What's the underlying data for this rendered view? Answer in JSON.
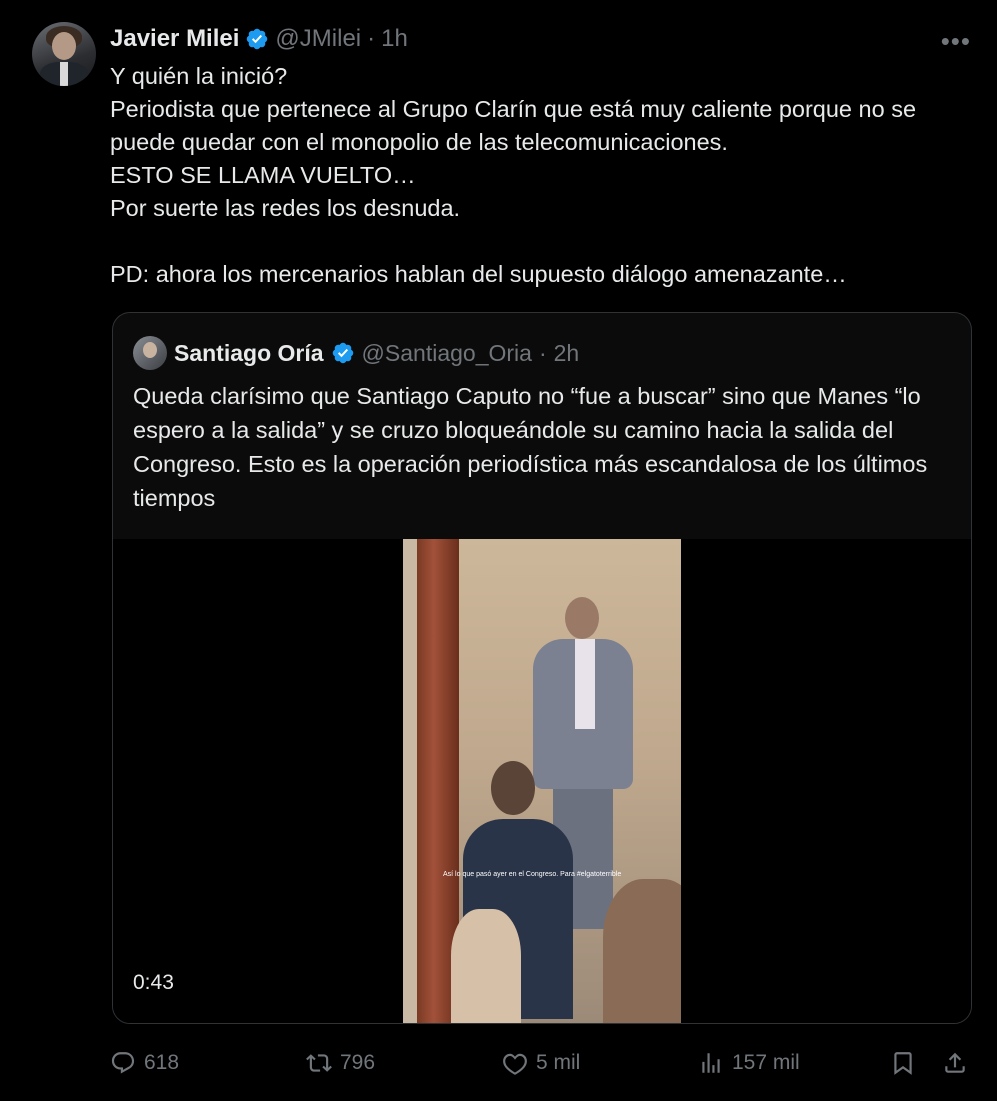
{
  "author": {
    "name": "Javier Milei",
    "handle": "@JMilei",
    "separator": "·",
    "time": "1h"
  },
  "tweet_text": [
    "Y quién la inició?",
    "Periodista que pertenece al Grupo Clarín que está muy caliente porque no se puede quedar con el monopolio de las telecomunicaciones.",
    "ESTO SE LLAMA VUELTO…",
    "Por suerte las redes los desnuda.",
    "",
    "PD: ahora los mercenarios hablan del supuesto diálogo amenazante…"
  ],
  "quote": {
    "name": "Santiago Oría",
    "handle": "@Santiago_Oria",
    "separator": "·",
    "time": "2h",
    "text": "Queda clarísimo que Santiago Caputo no “fue a buscar” sino que Manes “lo espero a la salida” y se cruzo bloqueándole su camino hacia la salida del Congreso. Esto es la operación periodística más escandalosa de los últimos tiempos",
    "video_duration": "0:43",
    "video_caption": "Así lo que pasó ayer en el Congreso. Para #elgatoterrible"
  },
  "actions": {
    "replies": "618",
    "retweets": "796",
    "likes": "5 mil",
    "views": "157 mil"
  },
  "colors": {
    "background": "#000000",
    "text": "#e7e9ea",
    "muted": "#71767b",
    "verified": "#1d9bf0"
  }
}
